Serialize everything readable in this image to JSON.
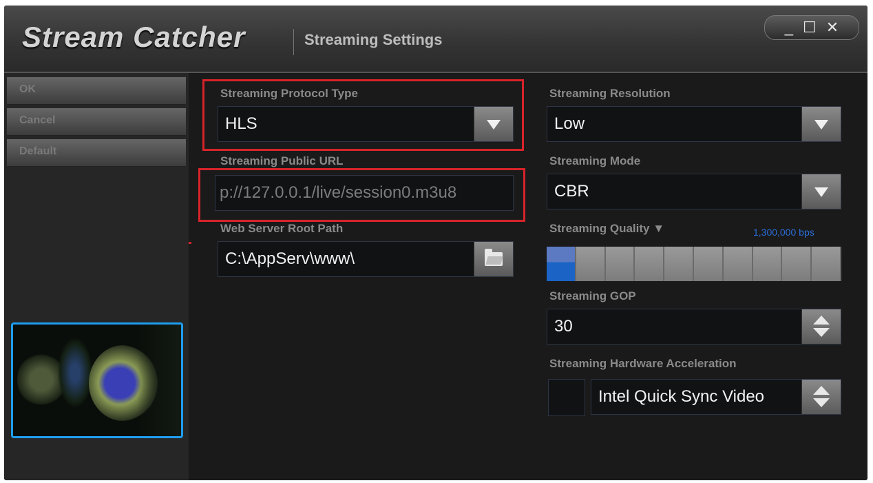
{
  "window": {
    "app_title": "Stream Catcher",
    "section_title": "Streaming Settings",
    "controls": {
      "minimize": "_",
      "maximize": "☐",
      "close": "✕"
    }
  },
  "sidebar": {
    "ok": "OK",
    "cancel": "Cancel",
    "default": "Default"
  },
  "settings": {
    "protocol": {
      "label": "Streaming Protocol Type",
      "value": "HLS"
    },
    "public_url": {
      "label": "Streaming Public URL",
      "value": "p://127.0.0.1/live/session0.m3u8"
    },
    "web_root": {
      "label": "Web Server Root Path",
      "value": "C:\\AppServ\\www\\"
    },
    "resolution": {
      "label": "Streaming Resolution",
      "value": "Low"
    },
    "mode": {
      "label": "Streaming Mode",
      "value": "CBR"
    },
    "quality": {
      "label": "Streaming Quality ▼",
      "bitrate": "1,300,000 bps",
      "level_segments_on": 1,
      "level_segments_total": 10
    },
    "gop": {
      "label": "Streaming GOP",
      "value": "30"
    },
    "hw_accel": {
      "label": "Streaming Hardware Acceleration",
      "value": "Intel Quick Sync Video",
      "enabled": false
    }
  },
  "colors": {
    "highlight": "#d8232a",
    "preview_border": "#1e9ef0",
    "quality_fill": "#1b64c6"
  }
}
